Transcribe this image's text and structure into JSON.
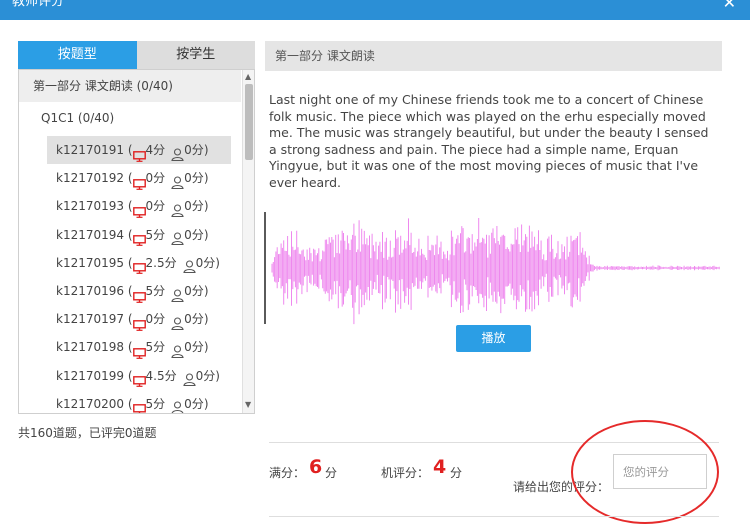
{
  "window": {
    "title": "教师评分",
    "close_glyph": "✕"
  },
  "tabs": [
    {
      "label": "按题型",
      "active": true
    },
    {
      "label": "按学生",
      "active": false
    }
  ],
  "list": {
    "section": "第一部分 课文朗读 (0/40)",
    "question": "Q1C1 (0/40)",
    "selected_index": 0,
    "items": [
      {
        "id": "k12170191",
        "machine": "4分",
        "teacher": "0分"
      },
      {
        "id": "k12170192",
        "machine": "0分",
        "teacher": "0分"
      },
      {
        "id": "k12170193",
        "machine": "0分",
        "teacher": "0分"
      },
      {
        "id": "k12170194",
        "machine": "5分",
        "teacher": "0分"
      },
      {
        "id": "k12170195",
        "machine": "2.5分",
        "teacher": "0分"
      },
      {
        "id": "k12170196",
        "machine": "5分",
        "teacher": "0分"
      },
      {
        "id": "k12170197",
        "machine": "0分",
        "teacher": "0分"
      },
      {
        "id": "k12170198",
        "machine": "5分",
        "teacher": "0分"
      },
      {
        "id": "k12170199",
        "machine": "4.5分",
        "teacher": "0分"
      },
      {
        "id": "k12170200",
        "machine": "5分",
        "teacher": "0分"
      }
    ]
  },
  "summary": "共160道题，已评完0道题",
  "right": {
    "header": "第一部分 课文朗读",
    "passage": "Last night one of my Chinese friends took me to a concert of Chinese folk music. The piece which was played on the erhu especially moved me. The music was strangely beautiful, but under the beauty I sensed a strong sadness and pain. The piece had a simple name, Erquan Yingyue, but it was one of the most moving pieces of music that I've ever heard.",
    "play_label": "播放",
    "waveform_color": "#ee88ee",
    "full_score_label": "满分：",
    "full_score_value": "6",
    "machine_score_label": "机评分：",
    "machine_score_value": "4",
    "unit": "分",
    "ask_label": "请给出您的评分：",
    "input_placeholder": "您的评分",
    "input_value": "",
    "accent_color": "#2b9ee5",
    "highlight_color": "#e02020"
  }
}
